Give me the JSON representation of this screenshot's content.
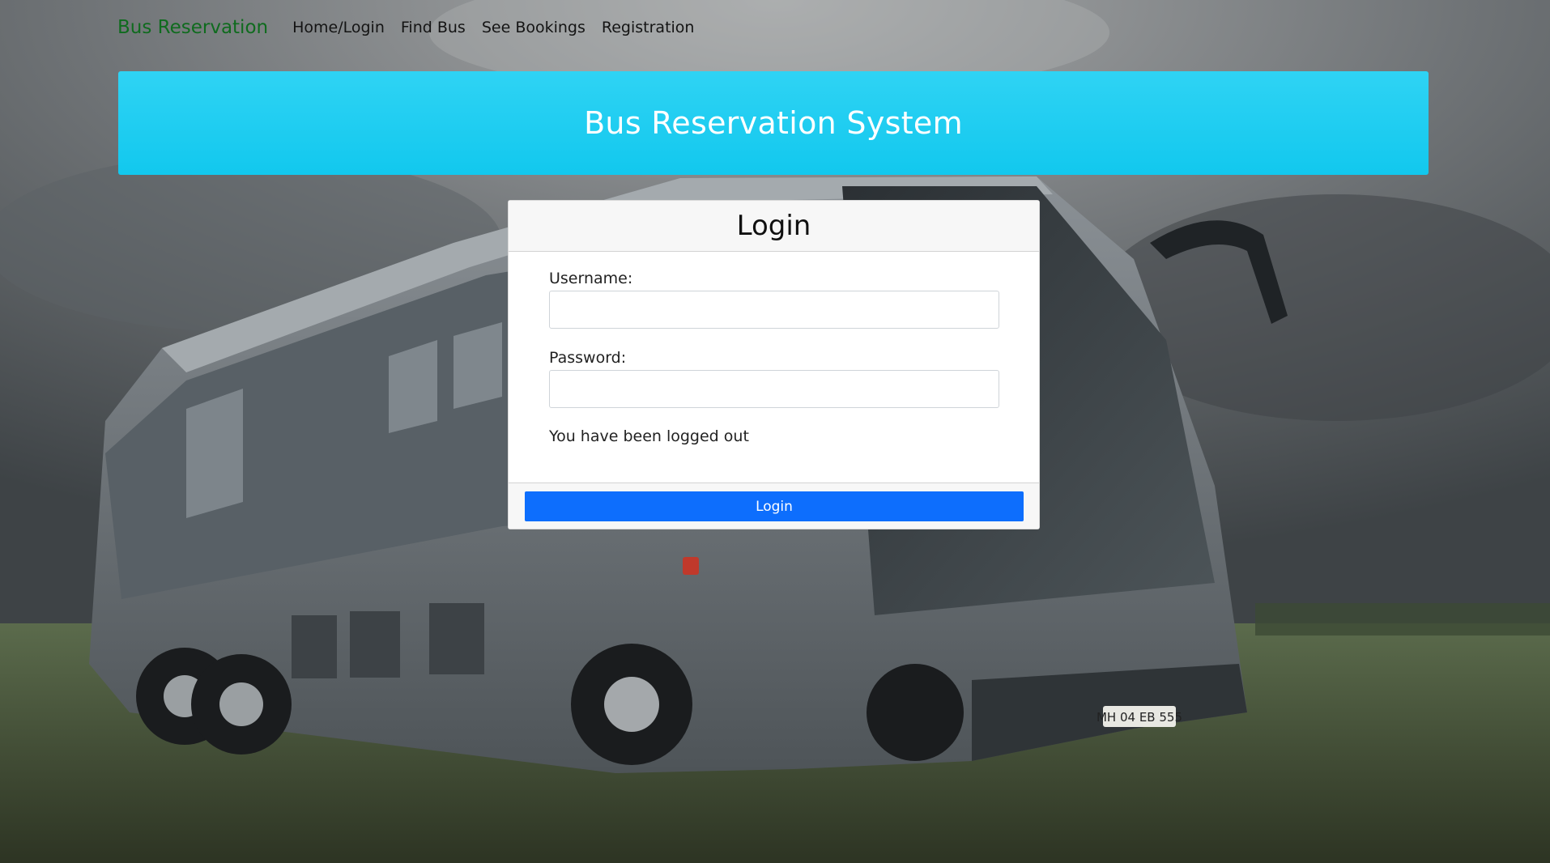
{
  "navbar": {
    "brand": "Bus Reservation",
    "links": [
      {
        "label": "Home/Login"
      },
      {
        "label": "Find Bus"
      },
      {
        "label": "See Bookings"
      },
      {
        "label": "Registration"
      }
    ]
  },
  "banner": {
    "title": "Bus Reservation System"
  },
  "login_card": {
    "title": "Login",
    "username_label": "Username:",
    "username_value": "",
    "password_label": "Password:",
    "password_value": "",
    "status_message": "You have been logged out",
    "submit_label": "Login"
  },
  "background": {
    "image": "bus-on-grass-field",
    "license_plate": "MH 04 EB 555"
  },
  "colors": {
    "brand": "#0f6b1e",
    "banner": "#1ccbf0",
    "button": "#0d6efd"
  }
}
